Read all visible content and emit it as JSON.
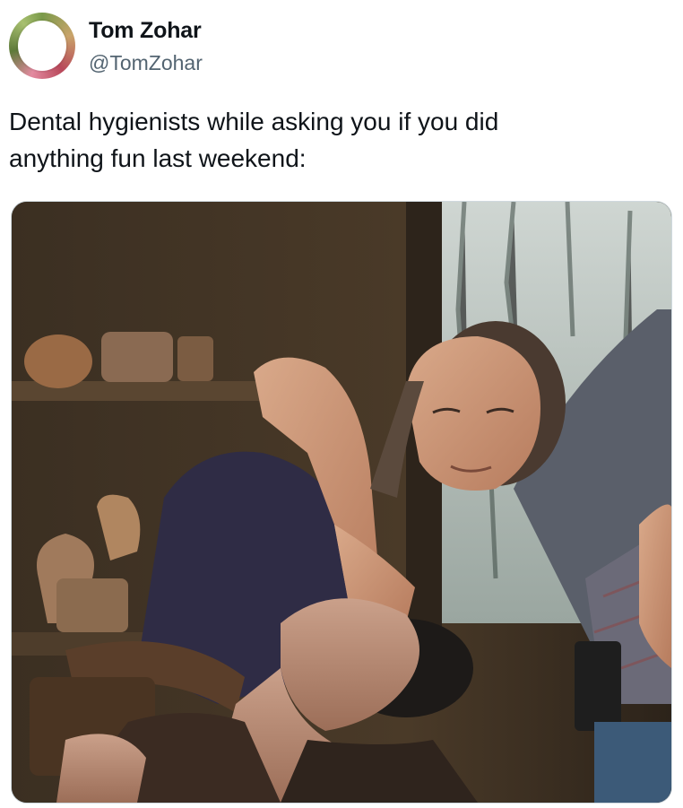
{
  "author": {
    "name": "Tom Zohar",
    "handle": "@TomZohar"
  },
  "tweet": {
    "text": "Dental hygienists while asking you if you did\nanything fun last weekend:"
  },
  "media": {
    "alt": "Woman in a dark tank top pressing her forearm into the neck of a man whose head is tilted back, in a rustic hut with clay pots on wooden shelves; a person in a plaid shirt and cap partly visible at right."
  }
}
